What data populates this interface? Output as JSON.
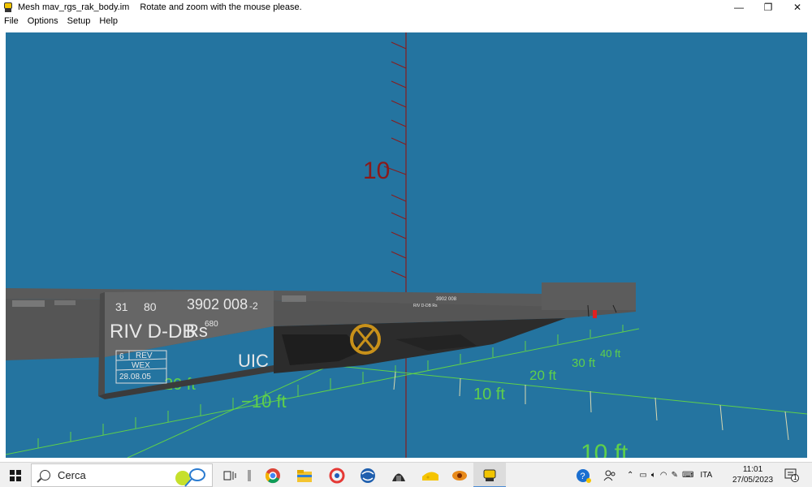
{
  "window": {
    "title": "Mesh mav_rgs_rak_body.im",
    "hint": "Rotate and zoom with the mouse please.",
    "minimize": "—",
    "restore": "❐",
    "close": "✕"
  },
  "menu": [
    "File",
    "Options",
    "Setup",
    "Help"
  ],
  "viewport": {
    "background": "#2474a0",
    "axis_labels": {
      "vertical_10": "10",
      "ft_neg10": "−10 ft",
      "ft_10": "10 ft",
      "ft_20": "20 ft",
      "ft_20_left": "20 ft",
      "ft_30": "30 ft",
      "ft_40": "40 ft",
      "ft_bottom": "10 ft"
    },
    "wagon_markings": {
      "code_a": "31",
      "code_b": "80",
      "number": "3902 008",
      "check_digit": "-2",
      "owner": "RIV D-DB",
      "type": "Rs",
      "type_suffix": "680",
      "rev_a": "6",
      "rev_b": "REV",
      "rev_c": "WEX",
      "rev_date": "28.08.05",
      "uic": "UIC",
      "far_number": "3902 008",
      "far_text": "RIV D-DB Rs"
    }
  },
  "taskbar": {
    "search_placeholder": "Cerca",
    "language": "ITA",
    "time": "11:01",
    "date": "27/05/2023",
    "notification_count": "1"
  }
}
